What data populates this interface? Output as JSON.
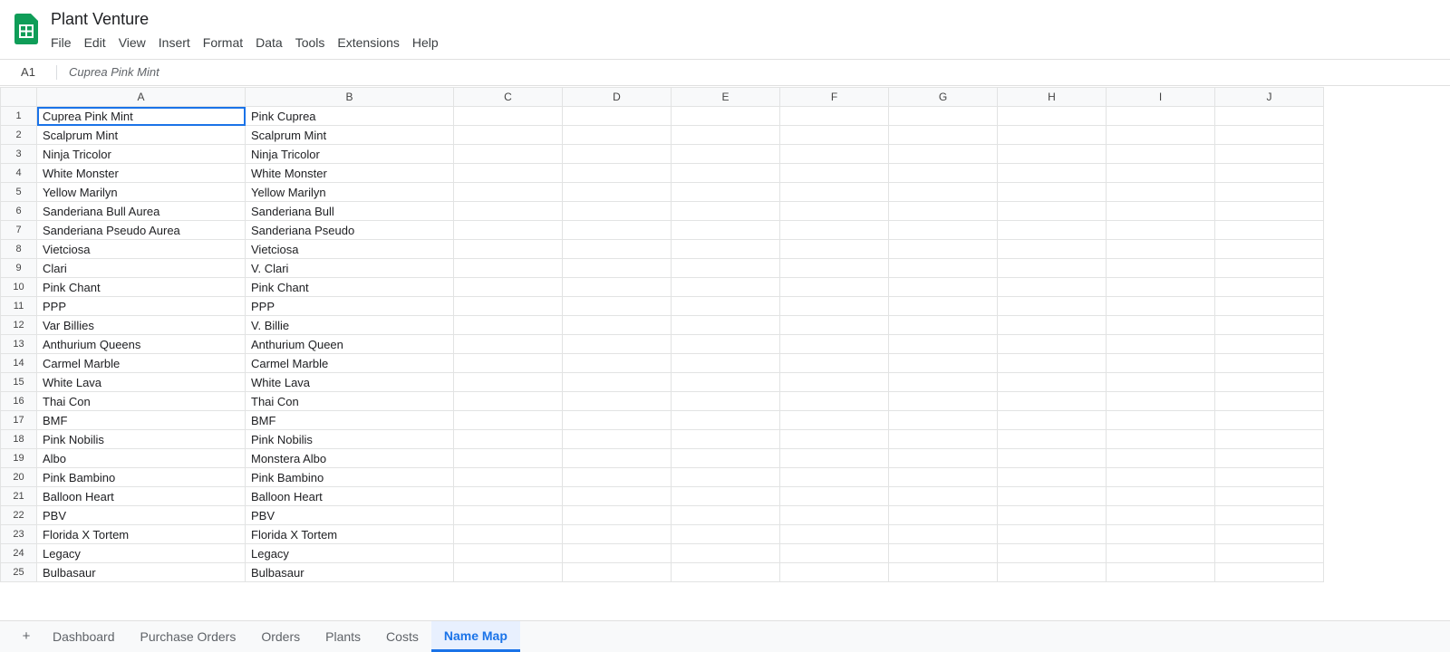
{
  "app": {
    "title": "Plant Venture",
    "brand_color": "#0f9d58",
    "logo_icon": "sheets-logo-icon"
  },
  "menu": [
    "File",
    "Edit",
    "View",
    "Insert",
    "Format",
    "Data",
    "Tools",
    "Extensions",
    "Help"
  ],
  "formula_bar": {
    "cell_ref": "A1",
    "value": "Cuprea Pink Mint"
  },
  "grid": {
    "columns": [
      "A",
      "B",
      "C",
      "D",
      "E",
      "F",
      "G",
      "H",
      "I",
      "J"
    ],
    "selected_cell": "A1",
    "selection_color": "#1a73e8",
    "rows": [
      {
        "num": "1",
        "a": "Cuprea Pink Mint",
        "b": "Pink Cuprea"
      },
      {
        "num": "2",
        "a": "Scalprum Mint",
        "b": "Scalprum Mint"
      },
      {
        "num": "3",
        "a": "Ninja Tricolor",
        "b": "Ninja Tricolor"
      },
      {
        "num": "4",
        "a": "White Monster",
        "b": "White Monster"
      },
      {
        "num": "5",
        "a": "Yellow Marilyn",
        "b": "Yellow Marilyn"
      },
      {
        "num": "6",
        "a": "Sanderiana Bull Aurea",
        "b": "Sanderiana Bull"
      },
      {
        "num": "7",
        "a": "Sanderiana Pseudo Aurea",
        "b": "Sanderiana Pseudo"
      },
      {
        "num": "8",
        "a": "Vietciosa",
        "b": "Vietciosa"
      },
      {
        "num": "9",
        "a": "Clari",
        "b": "V. Clari"
      },
      {
        "num": "10",
        "a": "Pink Chant",
        "b": "Pink Chant"
      },
      {
        "num": "11",
        "a": "PPP",
        "b": "PPP"
      },
      {
        "num": "12",
        "a": "Var Billies",
        "b": "V. Billie"
      },
      {
        "num": "13",
        "a": "Anthurium Queens",
        "b": "Anthurium Queen"
      },
      {
        "num": "14",
        "a": "Carmel Marble",
        "b": "Carmel Marble"
      },
      {
        "num": "15",
        "a": "White Lava",
        "b": "White Lava"
      },
      {
        "num": "16",
        "a": "Thai Con",
        "b": "Thai Con"
      },
      {
        "num": "17",
        "a": "BMF",
        "b": "BMF"
      },
      {
        "num": "18",
        "a": "Pink Nobilis",
        "b": "Pink Nobilis"
      },
      {
        "num": "19",
        "a": "Albo",
        "b": "Monstera Albo"
      },
      {
        "num": "20",
        "a": "Pink Bambino",
        "b": "Pink Bambino"
      },
      {
        "num": "21",
        "a": "Balloon Heart",
        "b": "Balloon Heart"
      },
      {
        "num": "22",
        "a": "PBV",
        "b": "PBV"
      },
      {
        "num": "23",
        "a": "Florida X Tortem",
        "b": "Florida X Tortem"
      },
      {
        "num": "24",
        "a": "Legacy",
        "b": "Legacy"
      },
      {
        "num": "25",
        "a": "Bulbasaur",
        "b": "Bulbasaur"
      }
    ]
  },
  "sheet_tabs": {
    "add_label": "+",
    "active": "Name Map",
    "tabs": [
      "Dashboard",
      "Purchase Orders",
      "Orders",
      "Plants",
      "Costs",
      "Name Map"
    ]
  }
}
